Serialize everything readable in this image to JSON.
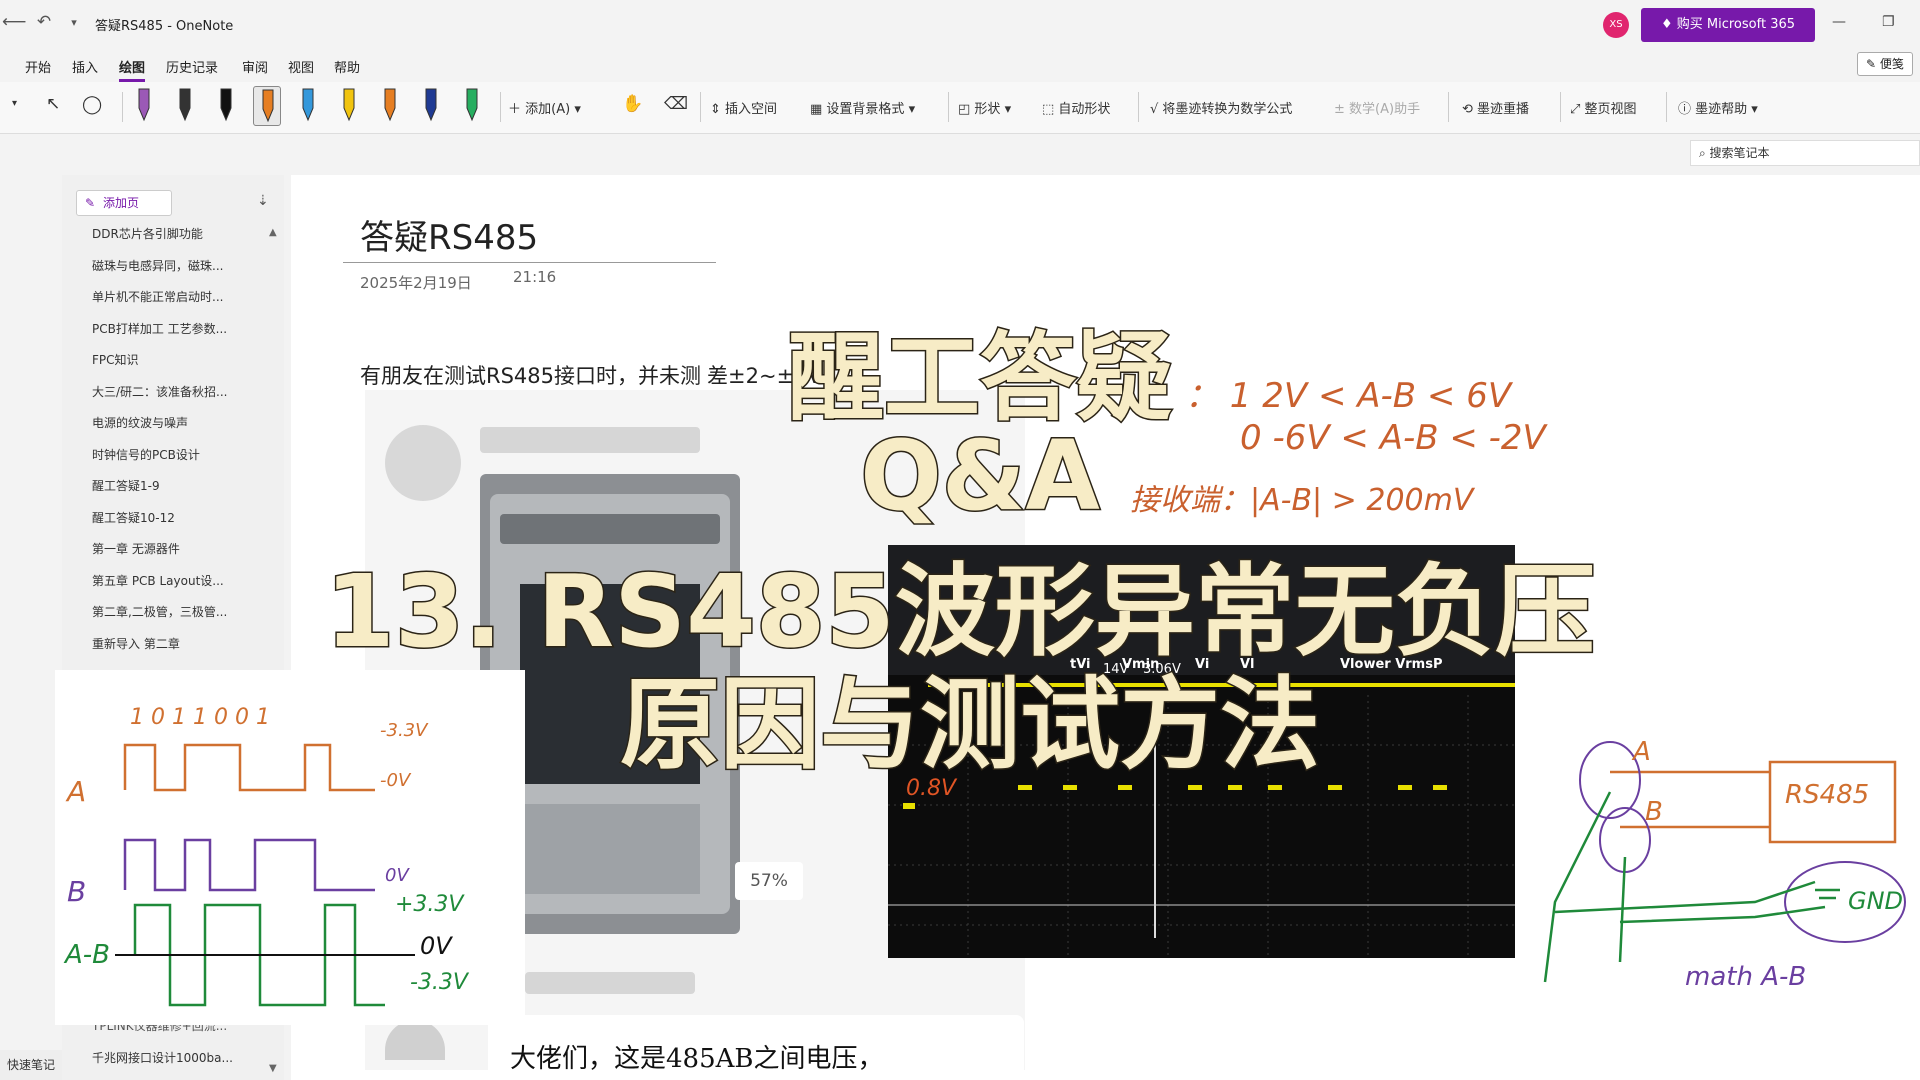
{
  "window": {
    "title": "答疑RS485  -  OneNote",
    "avatar_initials": "XS",
    "buy_label": "购买 Microsoft 365",
    "minimize": "—",
    "restore": "❐"
  },
  "menu": {
    "items": [
      "开始",
      "插入",
      "绘图",
      "历史记录",
      "审阅",
      "视图",
      "帮助"
    ],
    "active": "绘图",
    "sticky_label": "便笺"
  },
  "ribbon": {
    "add_label": "添加(A)",
    "insert_space": "插入空间",
    "background_format": "设置背景格式",
    "shapes": "形状",
    "auto_shapes": "自动形状",
    "ink_to_math": "将墨迹转换为数学公式",
    "math_assistant": "数学(A)助手",
    "ink_replay": "墨迹重播",
    "full_page_view": "整页视图",
    "ink_help": "墨迹帮助",
    "pen_colors": [
      "#9b59b6",
      "#333333",
      "#111111",
      "#e67e22",
      "#3498db",
      "#f1c40f",
      "#e67e22",
      "#1f3a93",
      "#27ae60"
    ]
  },
  "search": {
    "placeholder": "搜索笔记本"
  },
  "sidebar": {
    "add_page_label": "添加页",
    "pages": [
      "DDR芯片各引脚功能",
      "磁珠与电感异同，磁珠...",
      "单片机不能正常启动时...",
      "PCB打样加工 工艺参数...",
      "FPC知识",
      "大三/研二：该准备秋招...",
      "电源的纹波与噪声",
      "时钟信号的PCB设计",
      "醒工答疑1-9",
      "醒工答疑10-12",
      "第一章 无源器件",
      "第五章 PCB Layout设...",
      "第二章,二极管，三极管...",
      "重新导入 第二章"
    ],
    "bottom_pages": [
      "TPLINK仪器维修+回流...",
      "千兆网接口设计1000ba..."
    ],
    "quick_notes": "快速笔记"
  },
  "page": {
    "title": "答疑RS485",
    "date": "2025年2月19日",
    "time": "21:16",
    "body_text": "有朋友在测试RS485接口时，并未测",
    "body_text_tail": "差±2~±6V",
    "zoom_badge": "57%",
    "chat_text": "大佬们，这是485AB之间电压，"
  },
  "handwriting": {
    "driver_line1": "：  1       2V < A-B < 6V",
    "driver_line2": "0      -6V < A-B < -2V",
    "receiver": "接收端：|A-B| > 200mV",
    "bits": "1  0  1 1   0 0  1",
    "label_a": "A",
    "label_b": "B",
    "label_ab": "A-B",
    "v33": "-3.3V",
    "v0": "-0V",
    "vplus33": "+3.3V",
    "v0b": "0V",
    "vminus33": "-3.3V",
    "right_a": "A",
    "right_b": "B",
    "rs485": "RS485",
    "gnd": "GND",
    "math": "math   A-B",
    "scope_label": "0.8V"
  },
  "scope": {
    "header_cells": [
      "tVi",
      "Vmin",
      "Vi",
      "Vl",
      "Vlower VrmsP"
    ],
    "values": [
      "14V",
      "3.06V"
    ]
  },
  "overlay": {
    "line1": "醒工答疑",
    "line2": "Q&A",
    "line3": "13. RS485波形异常无负压",
    "line4": "原因与测试方法"
  }
}
